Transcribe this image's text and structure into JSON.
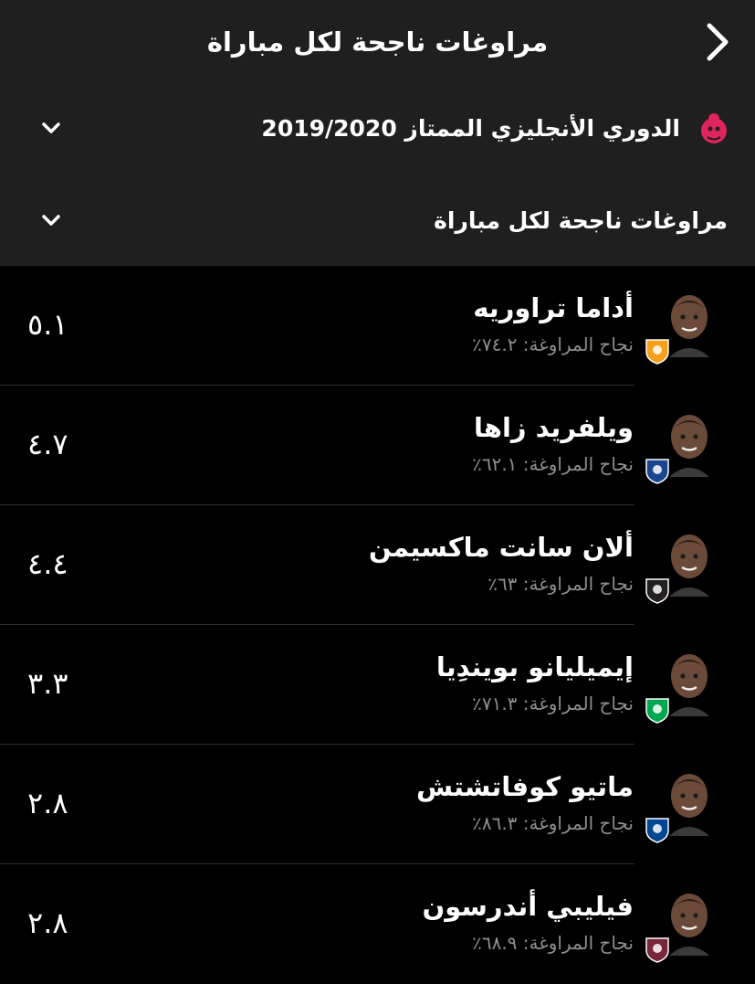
{
  "header": {
    "title": "مراوغات ناجحة لكل مباراة",
    "back_icon": "chevron-right-icon"
  },
  "filters": {
    "league": "الدوري الأنجليزي الممتاز 2019/2020",
    "stat": "مراوغات ناجحة لكل مباراة"
  },
  "colors": {
    "header_bg": "#1f1f1f",
    "list_bg": "#000000",
    "subtext": "#8e8e93",
    "league_logo": "#e0245e"
  },
  "players": [
    {
      "name": "أداما تراوريه",
      "subtitle": "نجاح المراوغة: ٧٤.٢٪",
      "value": "٥.١",
      "club_badge": "wolves-badge-icon",
      "badge_color": "#f9a01b"
    },
    {
      "name": "ويلفريد زاها",
      "subtitle": "نجاح المراوغة: ٦٢.١٪",
      "value": "٤.٧",
      "club_badge": "crystal-palace-badge-icon",
      "badge_color": "#1b458f"
    },
    {
      "name": "ألان سانت ماكسيمن",
      "subtitle": "نجاح المراوغة: ٦٣٪",
      "value": "٤.٤",
      "club_badge": "newcastle-badge-icon",
      "badge_color": "#241f20"
    },
    {
      "name": "إيميليانو بويندِيا",
      "subtitle": "نجاح المراوغة: ٧١.٣٪",
      "value": "٣.٣",
      "club_badge": "norwich-badge-icon",
      "badge_color": "#00a650"
    },
    {
      "name": "ماتيو كوفاتشتش",
      "subtitle": "نجاح المراوغة: ٨٦.٣٪",
      "value": "٢.٨",
      "club_badge": "chelsea-badge-icon",
      "badge_color": "#034694"
    },
    {
      "name": "فيليبي أندرسون",
      "subtitle": "نجاح المراوغة: ٦٨.٩٪",
      "value": "٢.٨",
      "club_badge": "west-ham-badge-icon",
      "badge_color": "#7a263a"
    }
  ]
}
